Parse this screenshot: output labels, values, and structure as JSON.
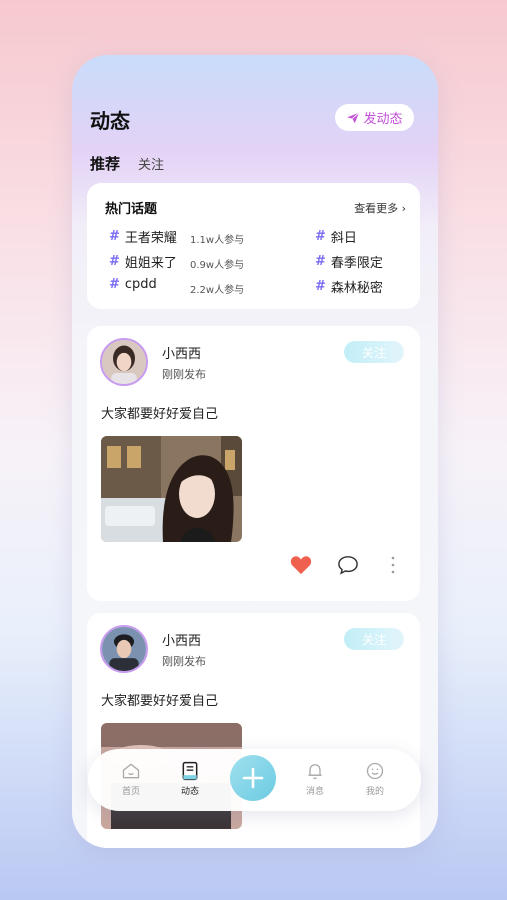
{
  "header": {
    "title": "动态",
    "post_button": "发动态"
  },
  "tabs": [
    {
      "label": "推荐",
      "active": true
    },
    {
      "label": "关注",
      "active": false
    }
  ],
  "hot_topics": {
    "title": "热门话题",
    "see_more": "查看更多",
    "left": [
      {
        "hash": "#",
        "name": "王者荣耀",
        "count": "1.1w人参与"
      },
      {
        "hash": "#",
        "name": "姐姐来了",
        "count": "0.9w人参与"
      },
      {
        "hash": "#",
        "name": "cpdd",
        "count": "2.2w人参与"
      }
    ],
    "right": [
      {
        "hash": "#",
        "name": "斜日"
      },
      {
        "hash": "#",
        "name": "春季限定"
      },
      {
        "hash": "#",
        "name": "森林秘密"
      }
    ]
  },
  "posts": [
    {
      "username": "小西西",
      "time": "刚刚发布",
      "follow": "关注",
      "text": "大家都要好好爱自己",
      "liked": true
    },
    {
      "username": "小西西",
      "time": "刚刚发布",
      "follow": "关注",
      "text": "大家都要好好爱自己",
      "liked": false
    }
  ],
  "nav": {
    "home": "首页",
    "feed": "动态",
    "messages": "消息",
    "mine": "我的"
  },
  "colors": {
    "accent": "#c44fd8",
    "hash": "#7a6cf3",
    "like": "#f0604f",
    "plus": "#6ccbe2"
  }
}
